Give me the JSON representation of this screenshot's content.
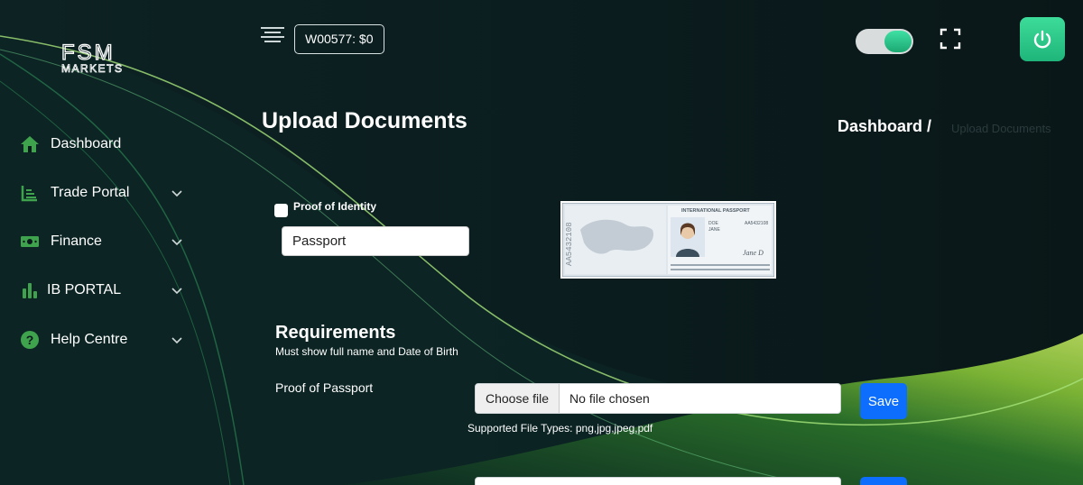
{
  "brand": {
    "logo_top": "FSM",
    "logo_bottom": "MARKETS"
  },
  "sidebar": {
    "items": [
      {
        "label": "Dashboard",
        "icon": "home-icon",
        "expandable": false
      },
      {
        "label": "Trade Portal",
        "icon": "chart-icon",
        "expandable": true
      },
      {
        "label": "Finance",
        "icon": "money-icon",
        "expandable": true
      },
      {
        "label": "IB PORTAL",
        "icon": "bar-chart-icon",
        "expandable": true
      },
      {
        "label": "Help Centre",
        "icon": "help-icon",
        "expandable": true
      }
    ]
  },
  "header": {
    "menu_icon": "hamburger-icon",
    "wallet": "W00577: $0",
    "theme_toggle_on": true,
    "fullscreen_icon": "fullscreen-icon",
    "power_icon": "power-icon"
  },
  "page": {
    "title": "Upload Documents",
    "breadcrumb": {
      "root": "Dashboard /",
      "current": "Upload Documents"
    }
  },
  "identity": {
    "checkbox_label": "Proof of Identity",
    "document_type": "Passport"
  },
  "sample_passport": {
    "heading": "INTERNATIONAL PASSPORT",
    "number": "AA5432108",
    "surname": "DOE",
    "given_name": "JANE",
    "signature": "Jane D"
  },
  "requirements": {
    "title": "Requirements",
    "description": "Must show full name and Date of Birth"
  },
  "upload": {
    "label": "Proof of Passport",
    "choose_button": "Choose file",
    "status": "No file chosen",
    "save_label": "Save",
    "supported": "Supported File Types: png,jpg,jpeg,pdf"
  },
  "colors": {
    "accent_green": "#33d694",
    "sidebar_icon_green": "#3fa34d",
    "primary_blue": "#0d6efd",
    "background": "#0b1a1c"
  }
}
